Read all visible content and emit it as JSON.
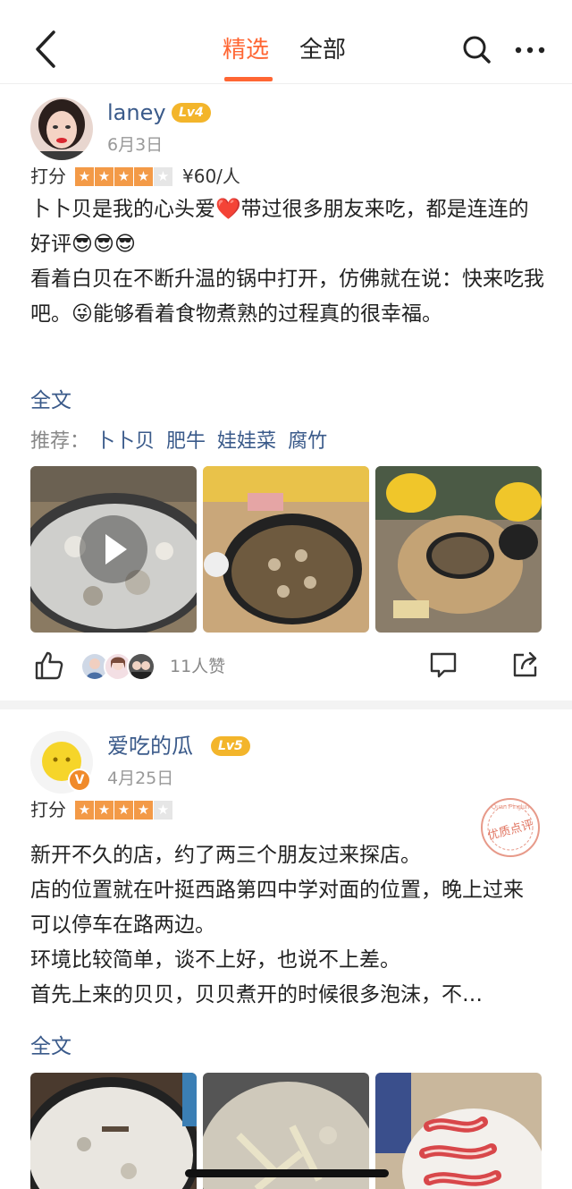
{
  "nav": {
    "tabs": [
      {
        "label": "精选",
        "active": true
      },
      {
        "label": "全部",
        "active": false
      }
    ],
    "accent_color": "#ff6633",
    "icons": [
      "back-icon",
      "search-icon",
      "more-icon"
    ]
  },
  "reviews": [
    {
      "user": "laney",
      "level": "Lv4",
      "date": "6月3日",
      "score_label": "打分",
      "stars": 4,
      "price": "¥60/人",
      "content": [
        "卜卜贝是我的心头爱❤️带过很多朋友来吃，都是连连的好评😎😎😎",
        "看着白贝在不断升温的锅中打开，仿佛就在说：快来吃我吧。😜能够看着食物煮熟的过程真的很幸福。"
      ],
      "full_text_link": "全文",
      "recommend_label": "推荐：",
      "recommend_items": [
        "卜卜贝",
        "肥牛",
        "娃娃菜",
        "腐竹"
      ],
      "likes": "11人赞"
    },
    {
      "user": "爱吃的瓜",
      "level": "Lv5",
      "date": "4月25日",
      "score_label": "打分",
      "stars": 4,
      "content": [
        "新开不久的店，约了两三个朋友过来探店。",
        "店的位置就在叶挺西路第四中学对面的位置，晚上过来可以停车在路两边。",
        "环境比较简单，谈不上好，也说不上差。",
        "首先上来的贝贝，贝贝煮开的时候很多泡沫，不…"
      ],
      "full_text_link": "全文",
      "badge_text": "优质点评",
      "badge_sub": "Quan Pinglun"
    }
  ]
}
